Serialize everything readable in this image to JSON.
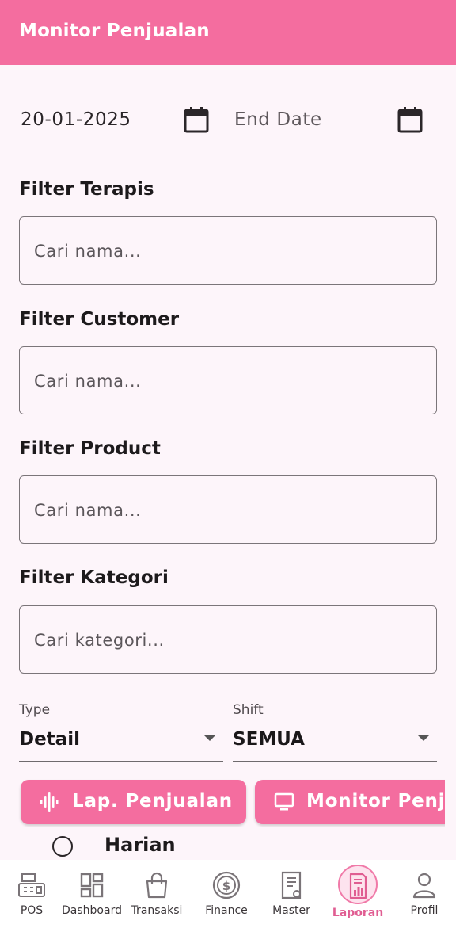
{
  "app": {
    "title": "Monitor Penjualan"
  },
  "dates": {
    "start": "20-01-2025",
    "end_placeholder": "End Date"
  },
  "filters": {
    "terapis": {
      "label": "Filter Terapis",
      "placeholder": "Cari nama..."
    },
    "customer": {
      "label": "Filter Customer",
      "placeholder": "Cari nama..."
    },
    "product": {
      "label": "Filter Product",
      "placeholder": "Cari nama..."
    },
    "kategori": {
      "label": "Filter Kategori",
      "placeholder": "Cari kategori..."
    }
  },
  "type": {
    "label": "Type",
    "value": "Detail"
  },
  "shift": {
    "label": "Shift",
    "value": "SEMUA"
  },
  "buttons": {
    "lap_penjualan": "Lap. Penjualan",
    "monitor_penjualan": "Monitor Penjualan"
  },
  "radio": {
    "harian": "Harian"
  },
  "nav": {
    "items": [
      {
        "label": "POS",
        "icon": "cash-register-icon"
      },
      {
        "label": "Dashboard",
        "icon": "dashboard-icon"
      },
      {
        "label": "Transaksi",
        "icon": "shopping-bag-icon"
      },
      {
        "label": "Finance",
        "icon": "dollar-coin-icon"
      },
      {
        "label": "Master",
        "icon": "document-gear-icon"
      },
      {
        "label": "Laporan",
        "icon": "report-chart-icon",
        "active": true
      },
      {
        "label": "Profil",
        "icon": "person-icon"
      }
    ]
  },
  "colors": {
    "primary": "#f46d9f",
    "background": "#fdf5fa",
    "active_label": "#e05d92"
  }
}
